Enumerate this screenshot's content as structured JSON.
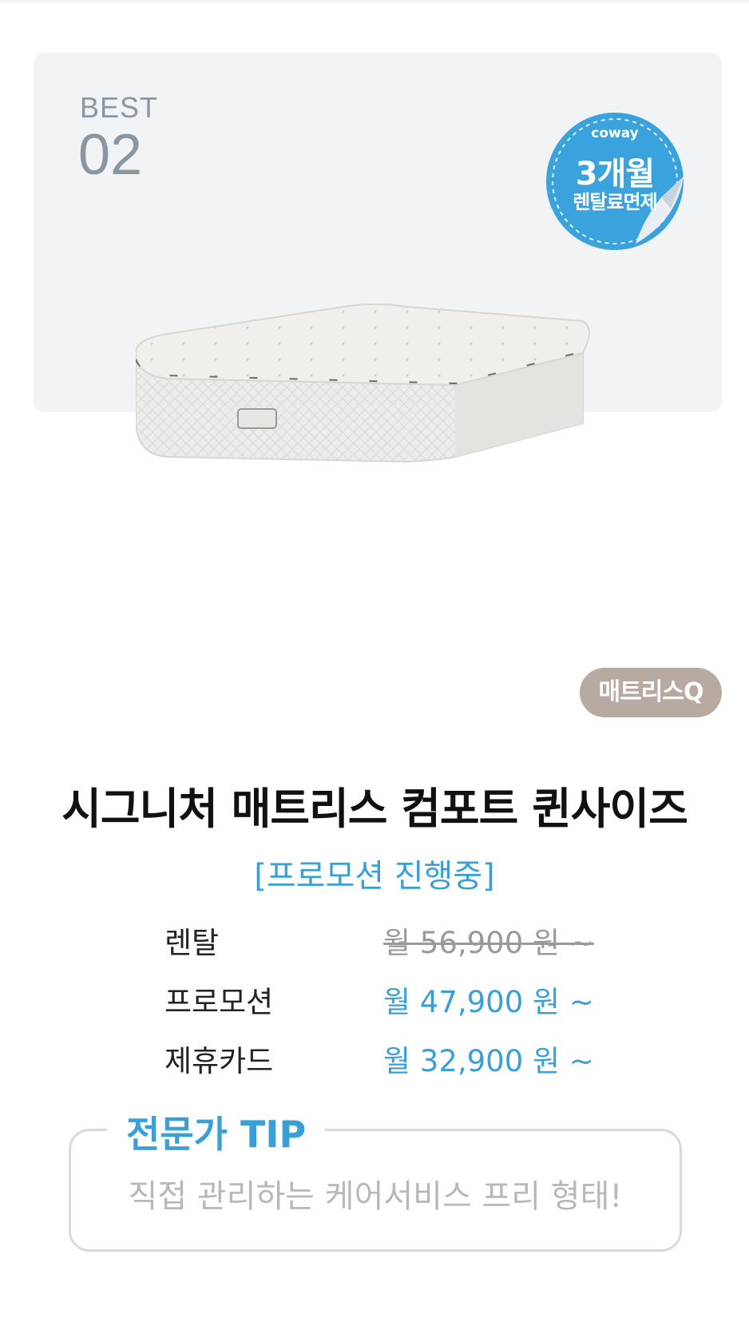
{
  "hero": {
    "best_label": "BEST",
    "best_number": "02",
    "badge": {
      "brand": "coway",
      "line1": "3개월",
      "line2": "렌탈료면제"
    }
  },
  "category_tag": "매트리스Q",
  "product_title": "시그니처 매트리스 컴포트 퀸사이즈",
  "promo_status": "[프로모션 진행중]",
  "prices": [
    {
      "label": "렌탈",
      "value": "월 56,900 원 ~",
      "struck": true
    },
    {
      "label": "프로모션",
      "value": "월 47,900 원 ~",
      "struck": false
    },
    {
      "label": "제휴카드",
      "value": "월 32,900 원 ~",
      "struck": false
    }
  ],
  "tip": {
    "title": "전문가 TIP",
    "text": "직접 관리하는 케어서비스 프리 형태!"
  },
  "colors": {
    "accent": "#3a9fd6",
    "tag": "#b8a9a3",
    "hero_bg": "#f1f3f4"
  }
}
